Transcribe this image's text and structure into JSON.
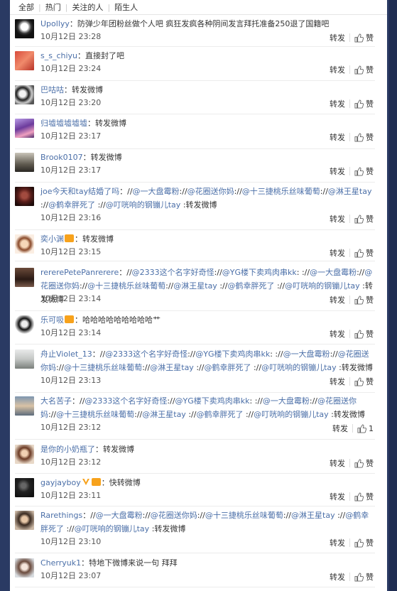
{
  "tabs": [
    "全部",
    "热门",
    "关注的人",
    "陌生人"
  ],
  "actions": {
    "repost": "转发",
    "like": "赞"
  },
  "comments": [
    {
      "user": "Upollyy",
      "parts": [
        {
          "t": "：防弹少年团粉丝做个人吧 疯狂发疯各种阴间发言拜托准备250退了国籍吧",
          "k": "text"
        }
      ],
      "time": "10月12日 23:28"
    },
    {
      "user": "s_s_chiyu",
      "parts": [
        {
          "t": "：直接封了吧",
          "k": "text"
        }
      ],
      "time": "10月12日 23:24"
    },
    {
      "user": "巴咕咕",
      "parts": [
        {
          "t": "：转发微博",
          "k": "text"
        }
      ],
      "time": "10月12日 23:20"
    },
    {
      "user": "归墟墟墟墟墟",
      "parts": [
        {
          "t": "：转发微博",
          "k": "text"
        }
      ],
      "time": "10月12日 23:17"
    },
    {
      "user": "Brook0107",
      "parts": [
        {
          "t": "：转发微博",
          "k": "text"
        }
      ],
      "time": "10月12日 23:17"
    },
    {
      "user": "joe今天和tay结婚了吗",
      "parts": [
        {
          "t": "：//",
          "k": "text"
        },
        {
          "t": "@一大盘霉粉",
          "k": "at"
        },
        {
          "t": "://",
          "k": "text"
        },
        {
          "t": "@花圈送你妈",
          "k": "at"
        },
        {
          "t": "://",
          "k": "text"
        },
        {
          "t": "@十三捷桃乐丝味葡萄",
          "k": "at"
        },
        {
          "t": "://",
          "k": "text"
        },
        {
          "t": "@淋王星tay",
          "k": "at"
        },
        {
          "t": " ://",
          "k": "text"
        },
        {
          "t": "@鹤幸胖死了",
          "k": "at"
        },
        {
          "t": " ://",
          "k": "text"
        },
        {
          "t": "@叮咣响的钢镚儿tay",
          "k": "at"
        },
        {
          "t": " :转发微博",
          "k": "text"
        }
      ],
      "time": "10月12日 23:16"
    },
    {
      "user": "奕小渊",
      "badge": "orange",
      "parts": [
        {
          "t": "：转发微博",
          "k": "text"
        }
      ],
      "time": "10月12日 23:15"
    },
    {
      "user": "rererePetePanrerere",
      "parts": [
        {
          "t": "：//",
          "k": "text"
        },
        {
          "t": "@2333这个名字好奇怪",
          "k": "at"
        },
        {
          "t": "://",
          "k": "text"
        },
        {
          "t": "@YG楼下卖鸡肉串kk",
          "k": "at"
        },
        {
          "t": ": ://",
          "k": "text"
        },
        {
          "t": "@一大盘霉粉",
          "k": "at"
        },
        {
          "t": "://",
          "k": "text"
        },
        {
          "t": "@花圈送你妈",
          "k": "at"
        },
        {
          "t": "://",
          "k": "text"
        },
        {
          "t": "@十三捷桃乐丝味葡萄",
          "k": "at"
        },
        {
          "t": "://",
          "k": "text"
        },
        {
          "t": "@淋王星tay",
          "k": "at"
        },
        {
          "t": " ://",
          "k": "text"
        },
        {
          "t": "@鹤幸胖死了",
          "k": "at"
        },
        {
          "t": " ://",
          "k": "text"
        },
        {
          "t": "@叮咣响的钢镚儿tay",
          "k": "at"
        },
        {
          "t": " :转发微博",
          "k": "text"
        }
      ],
      "time": "10月12日 23:14"
    },
    {
      "user": "乐可吸",
      "badge": "orange",
      "parts": [
        {
          "t": "：哈哈哈哈哈哈哈哈哈艹",
          "k": "text"
        }
      ],
      "time": "10月12日 23:14"
    },
    {
      "user": "舟止Violet_13",
      "parts": [
        {
          "t": "：//",
          "k": "text"
        },
        {
          "t": "@2333这个名字好奇怪",
          "k": "at"
        },
        {
          "t": "://",
          "k": "text"
        },
        {
          "t": "@YG楼下卖鸡肉串kk",
          "k": "at"
        },
        {
          "t": ": ://",
          "k": "text"
        },
        {
          "t": "@一大盘霉粉",
          "k": "at"
        },
        {
          "t": "://",
          "k": "text"
        },
        {
          "t": "@花圈送你妈",
          "k": "at"
        },
        {
          "t": "://",
          "k": "text"
        },
        {
          "t": "@十三捷桃乐丝味葡萄",
          "k": "at"
        },
        {
          "t": "://",
          "k": "text"
        },
        {
          "t": "@淋王星tay",
          "k": "at"
        },
        {
          "t": " ://",
          "k": "text"
        },
        {
          "t": "@鹤幸胖死了",
          "k": "at"
        },
        {
          "t": " ://",
          "k": "text"
        },
        {
          "t": "@叮咣响的钢镚儿tay",
          "k": "at"
        },
        {
          "t": " :转发微博",
          "k": "text"
        }
      ],
      "time": "10月12日 23:13"
    },
    {
      "user": "大名苦子",
      "parts": [
        {
          "t": "：//",
          "k": "text"
        },
        {
          "t": "@2333这个名字好奇怪",
          "k": "at"
        },
        {
          "t": "://",
          "k": "text"
        },
        {
          "t": "@YG楼下卖鸡肉串kk",
          "k": "at"
        },
        {
          "t": ": ://",
          "k": "text"
        },
        {
          "t": "@一大盘霉粉",
          "k": "at"
        },
        {
          "t": "://",
          "k": "text"
        },
        {
          "t": "@花圈送你妈",
          "k": "at"
        },
        {
          "t": "://",
          "k": "text"
        },
        {
          "t": "@十三捷桃乐丝味葡萄",
          "k": "at"
        },
        {
          "t": "://",
          "k": "text"
        },
        {
          "t": "@淋王星tay",
          "k": "at"
        },
        {
          "t": " ://",
          "k": "text"
        },
        {
          "t": "@鹤幸胖死了",
          "k": "at"
        },
        {
          "t": " ://",
          "k": "text"
        },
        {
          "t": "@叮咣响的钢镚儿tay",
          "k": "at"
        },
        {
          "t": " :转发微博",
          "k": "text"
        }
      ],
      "time": "10月12日 23:12",
      "likes": "1"
    },
    {
      "user": "是你的小奶瓶了",
      "parts": [
        {
          "t": "：转发微博",
          "k": "text"
        }
      ],
      "time": "10月12日 23:12"
    },
    {
      "user": "gayjayboy",
      "badge": "vip",
      "parts": [
        {
          "t": "：快转微博",
          "k": "text"
        }
      ],
      "time": "10月12日 23:11"
    },
    {
      "user": "Rarethings",
      "parts": [
        {
          "t": "：//",
          "k": "text"
        },
        {
          "t": "@一大盘霉粉",
          "k": "at"
        },
        {
          "t": "://",
          "k": "text"
        },
        {
          "t": "@花圈送你妈",
          "k": "at"
        },
        {
          "t": "://",
          "k": "text"
        },
        {
          "t": "@十三捷桃乐丝味葡萄",
          "k": "at"
        },
        {
          "t": "://",
          "k": "text"
        },
        {
          "t": "@淋王星tay",
          "k": "at"
        },
        {
          "t": " ://",
          "k": "text"
        },
        {
          "t": "@鹤幸胖死了",
          "k": "at"
        },
        {
          "t": " ://",
          "k": "text"
        },
        {
          "t": "@叮咣响的钢镚儿tay",
          "k": "at"
        },
        {
          "t": " :转发微博",
          "k": "text"
        }
      ],
      "time": "10月12日 23:10"
    },
    {
      "user": "Cherryuk1",
      "parts": [
        {
          "t": "：特地下微博来说一句 拜拜",
          "k": "text"
        }
      ],
      "time": "10月12日 23:07"
    }
  ]
}
